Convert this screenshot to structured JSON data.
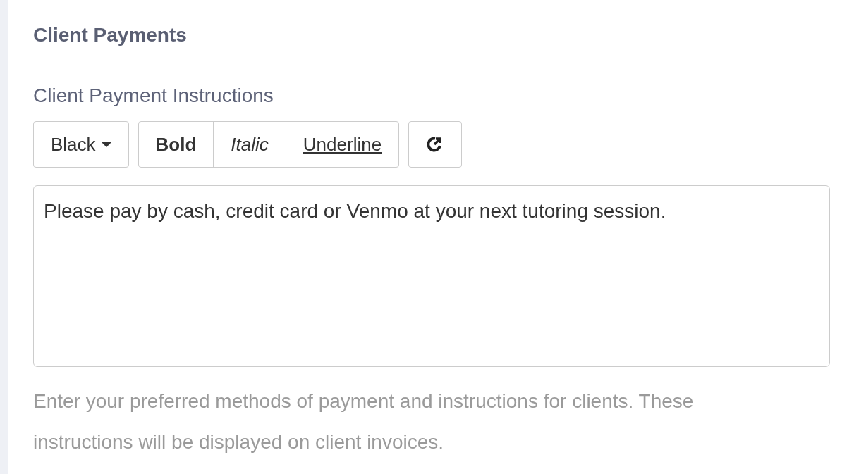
{
  "section_title": "Client Payments",
  "field_label": "Client Payment Instructions",
  "toolbar": {
    "color_dropdown": "Black",
    "format_buttons": [
      {
        "label": "Bold",
        "kind": "bold"
      },
      {
        "label": "Italic",
        "kind": "italic"
      },
      {
        "label": "Underline",
        "kind": "underline"
      }
    ]
  },
  "editor": {
    "value": "Please pay by cash, credit card or Venmo at your next tutoring session."
  },
  "help_text": "Enter your preferred methods of payment and instructions for clients. These instructions will be displayed on client invoices."
}
